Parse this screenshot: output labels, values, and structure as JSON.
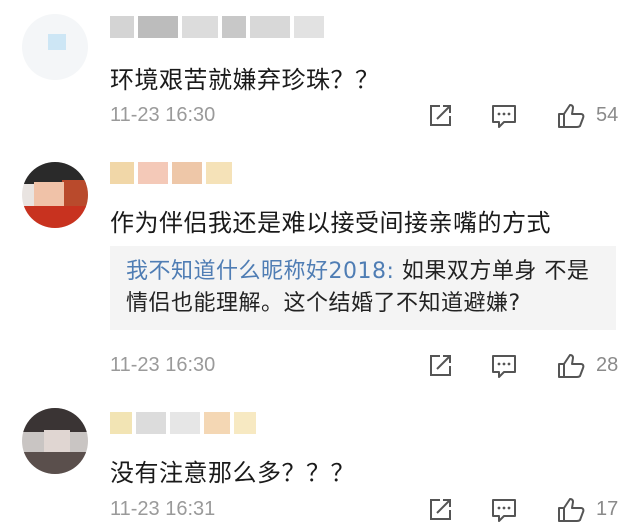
{
  "comments": [
    {
      "avatar": "avatar-blurred",
      "text": "环境艰苦就嫌弃珍珠？？",
      "time": "11-23 16:30",
      "likes": "54"
    },
    {
      "avatar": "avatar-blurred",
      "text": "作为伴侣我还是难以接受间接亲嘴的方式",
      "quote": {
        "author": "我不知道什么昵称好2018:",
        "text": " 如果双方单身 不是情侣也能理解。这个结婚了不知道避嫌?"
      },
      "time": "11-23 16:30",
      "likes": "28"
    },
    {
      "avatar": "avatar-blurred",
      "text": "没有注意那么多？？？",
      "time": "11-23 16:31",
      "likes": "17"
    }
  ],
  "icons": {
    "share": "share-icon",
    "reply": "comment-icon",
    "like": "thumbs-up-icon"
  },
  "colors": {
    "quote_author": "#4f7db4",
    "meta_text": "#9a9a9a",
    "quote_bg": "#f4f4f4"
  }
}
